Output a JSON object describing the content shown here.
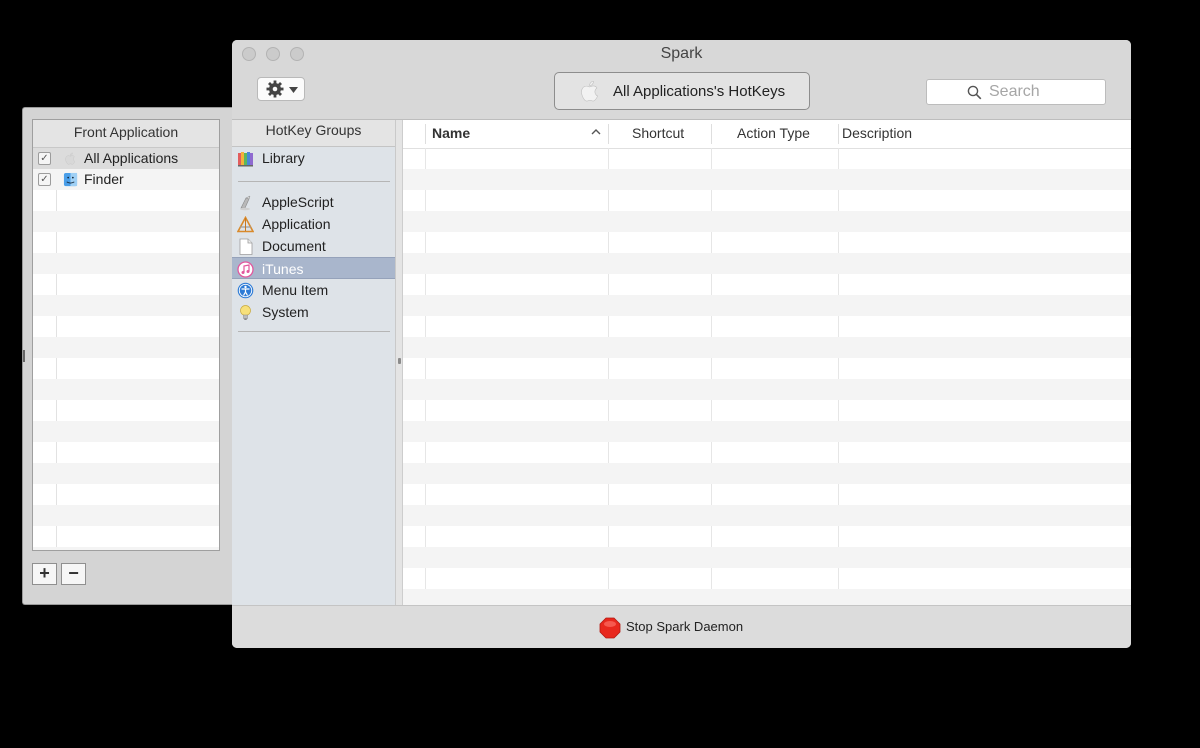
{
  "window": {
    "title": "Spark"
  },
  "toolbar": {
    "app_selector_label": "All Applications's HotKeys",
    "search_placeholder": "Search"
  },
  "drawer": {
    "header": "Front Application",
    "items": [
      {
        "label": "All Applications",
        "checked": true,
        "icon": "apple-icon"
      },
      {
        "label": "Finder",
        "checked": true,
        "icon": "finder-icon"
      }
    ],
    "add_label": "+",
    "remove_label": "−"
  },
  "groups": {
    "header": "HotKey Groups",
    "library": {
      "label": "Library",
      "icon": "library-icon"
    },
    "items": [
      {
        "label": "AppleScript",
        "icon": "applescript-icon"
      },
      {
        "label": "Application",
        "icon": "application-icon"
      },
      {
        "label": "Document",
        "icon": "document-icon"
      },
      {
        "label": "iTunes",
        "icon": "itunes-icon",
        "selected": true
      },
      {
        "label": "Menu Item",
        "icon": "accessibility-icon"
      },
      {
        "label": "System",
        "icon": "lightbulb-icon"
      }
    ]
  },
  "table": {
    "columns": [
      {
        "label": "Name",
        "sorted": "ascending"
      },
      {
        "label": "Shortcut"
      },
      {
        "label": "Action Type"
      },
      {
        "label": "Description"
      }
    ]
  },
  "footer": {
    "stop_label": "Stop Spark Daemon"
  },
  "colors": {
    "selection": "#a9b6cc",
    "sidebar_bg": "#dee3e8",
    "stop_red": "#e8281e"
  }
}
